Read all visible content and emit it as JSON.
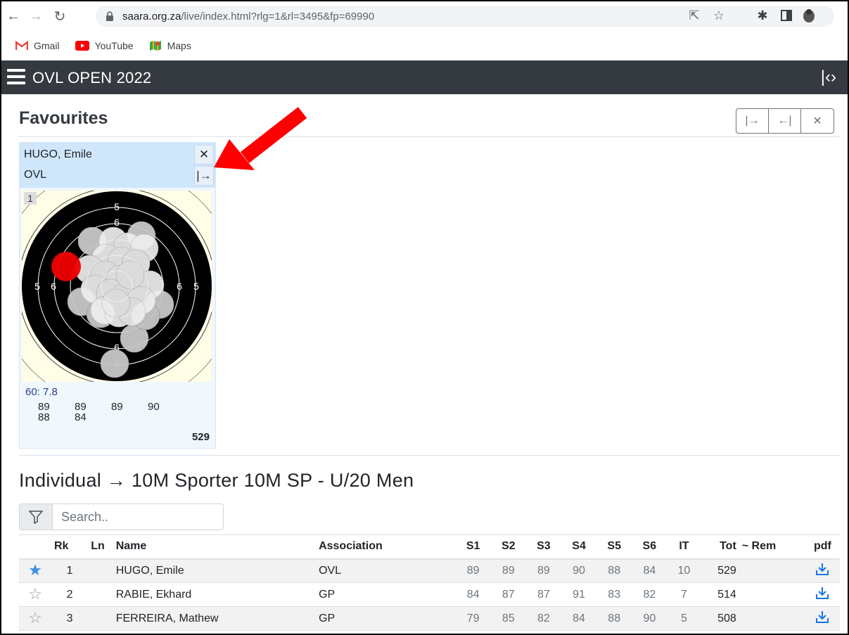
{
  "browser": {
    "url_host": "saara.org.za",
    "url_path": "/live/index.html?rlg=1&rl=3495&fp=69990",
    "bookmarks": [
      {
        "label": "Gmail",
        "icon": "gmail-icon"
      },
      {
        "label": "YouTube",
        "icon": "youtube-icon"
      },
      {
        "label": "Maps",
        "icon": "maps-icon"
      }
    ]
  },
  "app": {
    "title": "OVL OPEN 2022"
  },
  "favourites": {
    "heading": "Favourites",
    "card": {
      "name": "HUGO, Emile",
      "club": "OVL",
      "shot_number": "1",
      "average": "60: 7.8",
      "series": [
        "89",
        "89",
        "89",
        "90",
        "88",
        "84"
      ],
      "total": "529"
    }
  },
  "individual": {
    "heading": "Individual  →  10M Sporter 10M SP - U/20 Men",
    "search_placeholder": "Search..",
    "columns": [
      "",
      "Rk",
      "Ln",
      "Name",
      "Association",
      "S1",
      "S2",
      "S3",
      "S4",
      "S5",
      "S6",
      "IT",
      "Tot",
      "~ Rem",
      "pdf"
    ],
    "rows": [
      {
        "fav": true,
        "rk": "1",
        "ln": "",
        "name": "HUGO, Emile",
        "assoc": "OVL",
        "s": [
          "89",
          "89",
          "89",
          "90",
          "88",
          "84"
        ],
        "it": "10",
        "tot": "529",
        "rem": ""
      },
      {
        "fav": false,
        "rk": "2",
        "ln": "",
        "name": "RABIE, Ekhard",
        "assoc": "GP",
        "s": [
          "84",
          "87",
          "87",
          "91",
          "83",
          "82"
        ],
        "it": "7",
        "tot": "514",
        "rem": ""
      },
      {
        "fav": false,
        "rk": "3",
        "ln": "",
        "name": "FERREIRA, Mathew",
        "assoc": "GP",
        "s": [
          "79",
          "85",
          "82",
          "84",
          "88",
          "90"
        ],
        "it": "5",
        "tot": "508",
        "rem": ""
      }
    ]
  },
  "colors": {
    "navbar": "#343a40",
    "accent": "#3b8fe0",
    "arrow": "#ff0000",
    "card_head": "#cfe6fb"
  }
}
